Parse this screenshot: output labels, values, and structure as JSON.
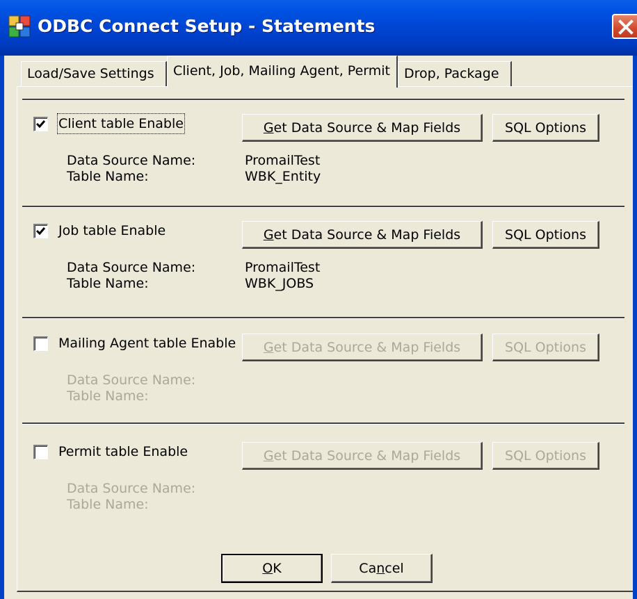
{
  "window": {
    "title": "ODBC Connect Setup - Statements",
    "close_icon": "close-icon"
  },
  "tabs": [
    {
      "label": "Load/Save Settings",
      "active": false
    },
    {
      "label": "Client, Job, Mailing Agent, Permit",
      "active": true
    },
    {
      "label": "Drop, Package",
      "active": false
    }
  ],
  "sections": {
    "client": {
      "checkbox_label": "Client table Enable",
      "checked": true,
      "enabled": true,
      "get_button": {
        "mnemonic": "G",
        "rest": "et Data Source & Map Fields"
      },
      "sql_button": "SQL Options",
      "ds_label": "Data Source Name:",
      "table_label": "Table Name:",
      "ds_value": "PromailTest",
      "table_value": "WBK_Entity"
    },
    "job": {
      "checkbox_label": "Job table Enable",
      "checked": true,
      "enabled": true,
      "get_button": {
        "mnemonic": "G",
        "rest": "et Data Source & Map Fields"
      },
      "sql_button": "SQL Options",
      "ds_label": "Data Source Name:",
      "table_label": "Table Name:",
      "ds_value": "PromailTest",
      "table_value": "WBK_JOBS"
    },
    "mailing_agent": {
      "checkbox_label": "Mailing Agent table Enable",
      "checked": false,
      "enabled": false,
      "get_button": {
        "mnemonic": "G",
        "rest": "et Data Source & Map Fields"
      },
      "sql_button": "SQL Options",
      "ds_label": "Data Source Name:",
      "table_label": "Table Name:"
    },
    "permit": {
      "checkbox_label": "Permit table Enable",
      "checked": false,
      "enabled": false,
      "get_button": {
        "mnemonic": "G",
        "rest": "et Data Source & Map Fields"
      },
      "sql_button": "SQL Options",
      "ds_label": "Data Source Name:",
      "table_label": "Table Name:"
    }
  },
  "footer": {
    "ok": {
      "mnemonic": "O",
      "rest": "K"
    },
    "cancel": {
      "pre": "Ca",
      "mnemonic": "n",
      "rest": "cel"
    }
  }
}
